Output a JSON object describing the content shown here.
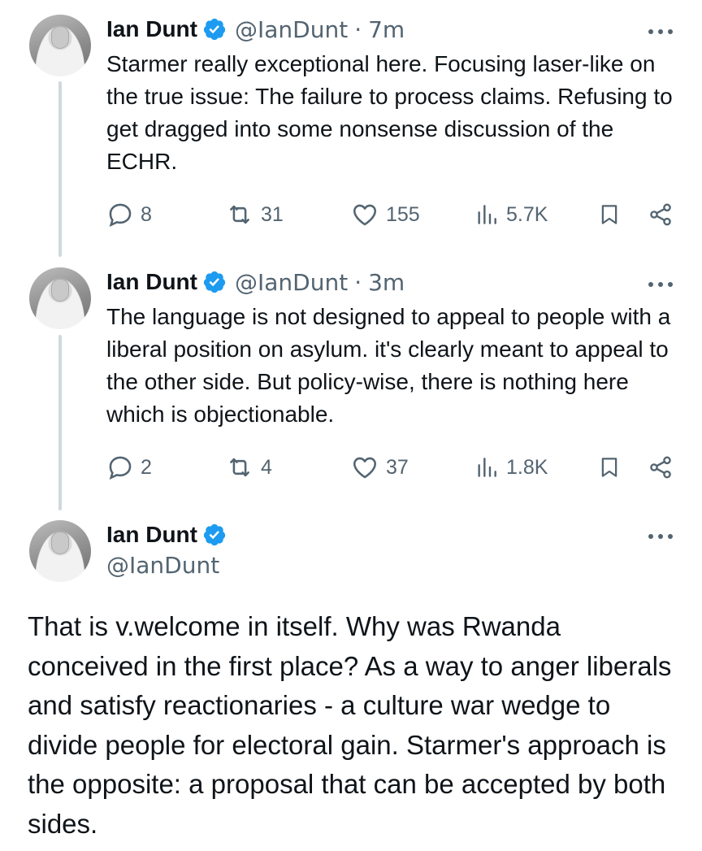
{
  "tweets": [
    {
      "author_name": "Ian Dunt",
      "handle": "@IanDunt",
      "separator": "·",
      "time": "7m",
      "text": "Starmer really exceptional here. Focusing laser-like on the true issue: The failure to process claims. Refusing to get dragged into some nonsense discussion of the ECHR.",
      "replies": "8",
      "retweets": "31",
      "likes": "155",
      "views": "5.7K"
    },
    {
      "author_name": "Ian Dunt",
      "handle": "@IanDunt",
      "separator": "·",
      "time": "3m",
      "text": "The language is not designed to appeal to people with a liberal position on asylum. it's clearly meant to appeal to the other side. But policy-wise, there is nothing here which is objectionable.",
      "replies": "2",
      "retweets": "4",
      "likes": "37",
      "views": "1.8K"
    }
  ],
  "main_tweet": {
    "author_name": "Ian Dunt",
    "handle": "@IanDunt",
    "text": "That is v.welcome in itself. Why was Rwanda conceived in the first place? As a way to anger liberals and satisfy reactionaries - a culture war wedge to divide people for electoral gain. Starmer's approach is the opposite: a proposal that can be accepted by both sides."
  },
  "colors": {
    "text": "#0f1419",
    "secondary": "#536471",
    "verified": "#1d9bf0",
    "thread_line": "#cfd9de"
  },
  "icons": [
    "reply-icon",
    "retweet-icon",
    "like-icon",
    "views-icon",
    "bookmark-icon",
    "share-icon",
    "verified-badge-icon",
    "more-icon"
  ]
}
